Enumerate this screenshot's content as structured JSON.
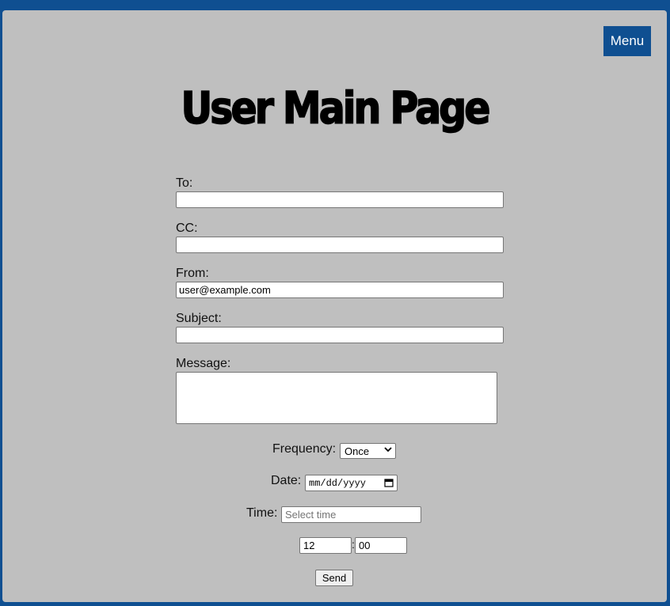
{
  "header": {
    "menu_label": "Menu",
    "title": "User Main Page"
  },
  "form": {
    "to_label": "To:",
    "to_value": "",
    "cc_label": "CC:",
    "cc_value": "",
    "from_label": "From:",
    "from_value": "user@example.com",
    "subject_label": "Subject:",
    "subject_value": "",
    "message_label": "Message:",
    "message_value": "",
    "frequency_label": "Frequency:",
    "frequency_value": "Once",
    "date_label": "Date:",
    "date_placeholder": "mm/dd/yyyy",
    "time_label": "Time:",
    "time_placeholder": "Select time",
    "hour_value": "12",
    "time_separator": ":",
    "minute_value": "00",
    "send_label": "Send"
  },
  "colors": {
    "accent": "#0f4f91",
    "panel": "#bfbfbf"
  },
  "icons": {
    "frequency_dropdown": "chevron-down-icon",
    "date_picker": "calendar-icon"
  }
}
